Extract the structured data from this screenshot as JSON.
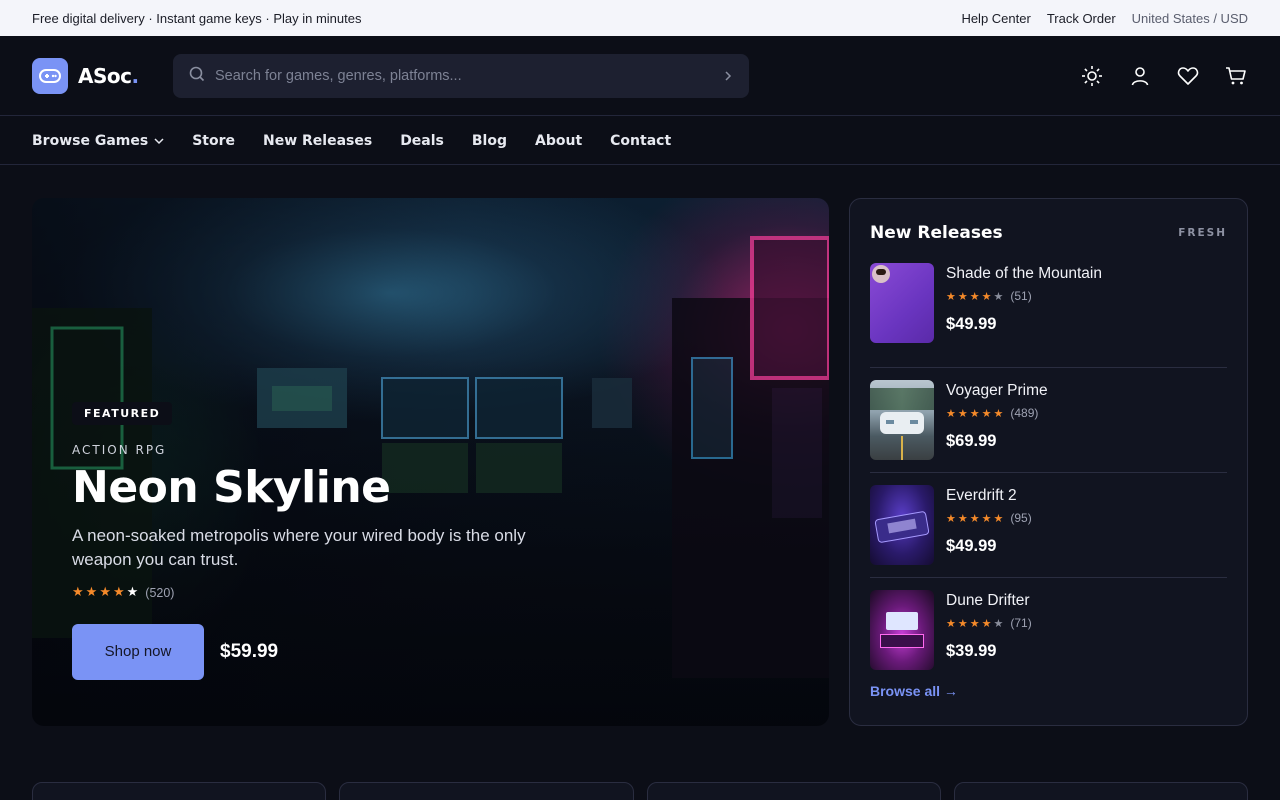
{
  "topbar": {
    "promo": "Free digital delivery · Instant game keys · Play in minutes",
    "help": "Help Center",
    "track": "Track Order",
    "region": "United States / USD"
  },
  "header": {
    "logo_text": "ASoc",
    "logo_dot": ".",
    "search_placeholder": "Search for games, genres, platforms...",
    "icons": [
      "sun-icon",
      "user-icon",
      "heart-icon",
      "cart-icon"
    ]
  },
  "nav": {
    "items": [
      {
        "label": "Browse Games",
        "has_dropdown": true
      },
      {
        "label": "Store"
      },
      {
        "label": "New Releases"
      },
      {
        "label": "Deals"
      },
      {
        "label": "Blog"
      },
      {
        "label": "About"
      },
      {
        "label": "Contact"
      }
    ]
  },
  "hero": {
    "badge": "FEATURED",
    "genre": "ACTION RPG",
    "title": "Neon Skyline",
    "description": "A neon-soaked metropolis where your wired body is the only weapon you can trust.",
    "rating": 4,
    "rating_count": "(520)",
    "cta": "Shop now",
    "price": "$59.99"
  },
  "releases": {
    "title": "New Releases",
    "tag": "FRESH",
    "items": [
      {
        "name": "Shade of the Mountain",
        "rating": 4,
        "count": "(51)",
        "price": "$49.99"
      },
      {
        "name": "Voyager Prime",
        "rating": 5,
        "count": "(489)",
        "price": "$69.99"
      },
      {
        "name": "Everdrift 2",
        "rating": 5,
        "count": "(95)",
        "price": "$49.99"
      },
      {
        "name": "Dune Drifter",
        "rating": 4,
        "count": "(71)",
        "price": "$39.99"
      }
    ],
    "browse_all": "Browse all →"
  },
  "colors": {
    "accent": "#7a93f5",
    "background": "#0c0e17",
    "star": "#f58a2a"
  }
}
